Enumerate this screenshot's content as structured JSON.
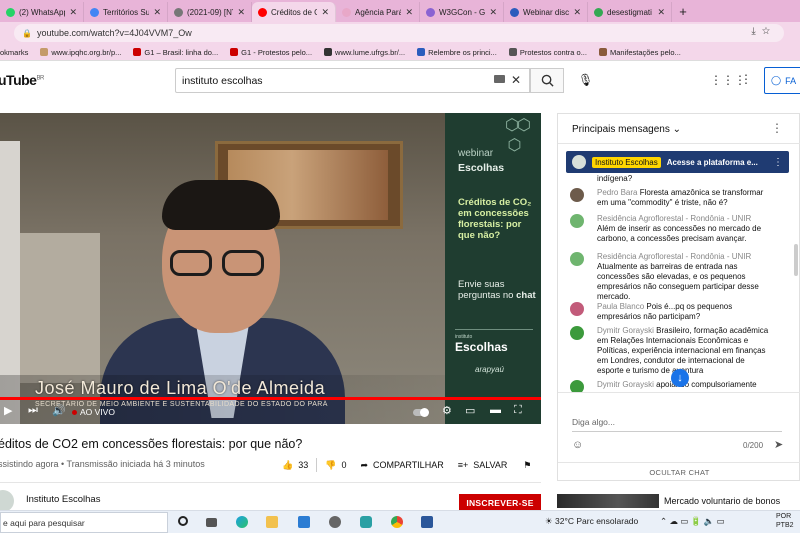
{
  "browser": {
    "tabs": [
      {
        "label": "(2) WhatsApp",
        "color": "#25d366"
      },
      {
        "label": "Territórios Sus",
        "color": "#4285f4"
      },
      {
        "label": "(2021-09) [NY",
        "color": "#777777"
      },
      {
        "label": "Créditos de C",
        "color": "#ff0000",
        "active": true
      },
      {
        "label": "Agência Pará",
        "color": "#e8a8c8"
      },
      {
        "label": "W3GCon - Ge",
        "color": "#8a63d2"
      },
      {
        "label": "Webinar discu",
        "color": "#2b5cbd"
      },
      {
        "label": "desestigmati",
        "color": "#34a853"
      }
    ],
    "new_tab": "+",
    "url": "youtube.com/watch?v=4J04VVM7_Ow",
    "bookmarks": [
      "okmarks",
      "www.ipqhc.org.br/p...",
      "G1 – Brasil: linha do...",
      "G1 - Protestos pelo...",
      "www.lume.ufrgs.br/...",
      "Relembre os princi...",
      "Protestos contra o...",
      "Manifestações pelo..."
    ]
  },
  "youtube": {
    "logo": "uTube",
    "logo_region": "BR",
    "search_value": "instituto escolhas",
    "signin_label": "FA"
  },
  "player": {
    "lower_third_name": "José Mauro de Lima O'de Almeida",
    "lower_third_role": "SECRETÁRIO DE MEIO AMBIENTE E SUSTENTABILIDADE DO ESTADO DO PARÁ",
    "panel": {
      "webinar": "webinar",
      "escolhas": "Escolhas",
      "question": "Créditos de CO₂ em concessões florestais: por que não?",
      "send_line1": "Envie suas perguntas no",
      "send_bold": "chat",
      "logo_small": "instituto",
      "logo_big": "Escolhas",
      "sponsor": "arapyaú"
    },
    "live_label": "AO VIVO",
    "progress": 1.0,
    "accent": "#ff0000"
  },
  "video": {
    "title": "éditos de CO2 em concessões florestais: por que não?",
    "meta": "ssistindo agora • Transmissão iniciada há 3 minutos",
    "likes": "33",
    "dislikes": "0",
    "share_label": "COMPARTILHAR",
    "save_label": "SALVAR",
    "channel": "Instituto Escolhas",
    "subscribe_label": "INSCREVER-SE"
  },
  "chat": {
    "header": "Principais mensagens",
    "pinned": {
      "badge": "Instituto Escolhas",
      "text": "Acesse a plataforma e..."
    },
    "messages": [
      {
        "author": "",
        "text": "indígena?",
        "color": "#ffffff"
      },
      {
        "author": "Pedro Bara",
        "text": "Floresta amazônica se transformar em uma \"commodity\" é triste, não é?",
        "color": "#6d5b4b"
      },
      {
        "author": "Residência Agroflorestal - Rondônia - UNIR",
        "text": "Além de inserir as concessões no mercado de carbono, a concessões precisam avançar.",
        "color": "#6fb56f"
      },
      {
        "author": "Residência Agroflorestal - Rondônia - UNIR",
        "text": "Atualmente as barreiras de entrada nas concessões são elevadas, e os pequenos empresários não conseguem participar desse mercado.",
        "color": "#6fb56f"
      },
      {
        "author": "Paula Blanco",
        "text": "Pois é...pq os pequenos empresários não participam?",
        "color": "#c25b7a"
      },
      {
        "author": "Dymitr Gorayski",
        "text": "Brasileiro, formação acadêmica em Relações Internacionais Econômicas e Políticas, experiência internacional em finanças em Londres, condutor de internacional de esporte e turismo de aventura",
        "color": "#3c9a3c"
      },
      {
        "author": "Dymitr Gorayski",
        "text": "apoiando compulsoriamente",
        "color": "#3c9a3c"
      }
    ],
    "input_placeholder": "Diga algo...",
    "char_count": "0/200",
    "hide_chat": "OCULTAR CHAT"
  },
  "suggestion": {
    "title": "Mercado voluntario de bonos"
  },
  "taskbar": {
    "search_placeholder": "e aqui para pesquisar",
    "weather": "32°C  Parc ensolarado",
    "lang": "POR",
    "layout": "PTB2"
  }
}
